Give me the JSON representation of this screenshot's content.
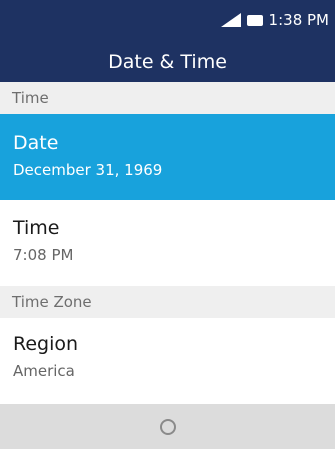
{
  "status_bar": {
    "time": "1:38 PM",
    "icons": [
      "signal-icon",
      "battery-icon"
    ]
  },
  "header": {
    "title": "Date & Time"
  },
  "sections": {
    "time": "Time",
    "time_zone": "Time Zone"
  },
  "items": {
    "date": {
      "title": "Date",
      "value": "December 31, 1969"
    },
    "time": {
      "title": "Time",
      "value": "7:08 PM"
    },
    "region": {
      "title": "Region",
      "value": "America"
    }
  },
  "softkeys": {
    "center_icon": "circle-icon"
  },
  "colors": {
    "header_bg": "#1e3262",
    "selected_bg": "#18a2dc",
    "section_bg": "#efefef",
    "softkey_bg": "#dcdcdc"
  }
}
